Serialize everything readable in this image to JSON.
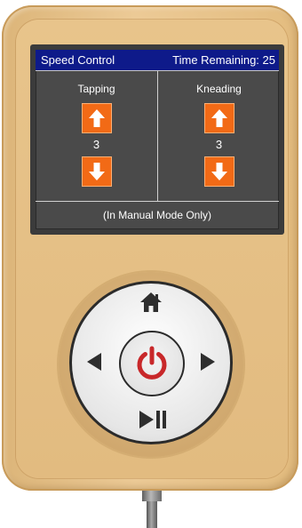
{
  "screen": {
    "title": "Speed Control",
    "time_remaining_label": "Time Remaining: 25",
    "footer": "(In Manual Mode Only)",
    "columns": [
      {
        "label": "Tapping",
        "value": "3"
      },
      {
        "label": "Kneading",
        "value": "3"
      }
    ]
  },
  "controls": {
    "home": "home-icon",
    "left": "left-arrow-icon",
    "right": "right-arrow-icon",
    "power": "power-icon",
    "play_pause": "play-pause-icon"
  },
  "colors": {
    "titlebar": "#0e1a8a",
    "screen": "#4a4a4a",
    "arrow_button": "#f26a16",
    "power": "#c8282a",
    "body": "#e6c086"
  }
}
